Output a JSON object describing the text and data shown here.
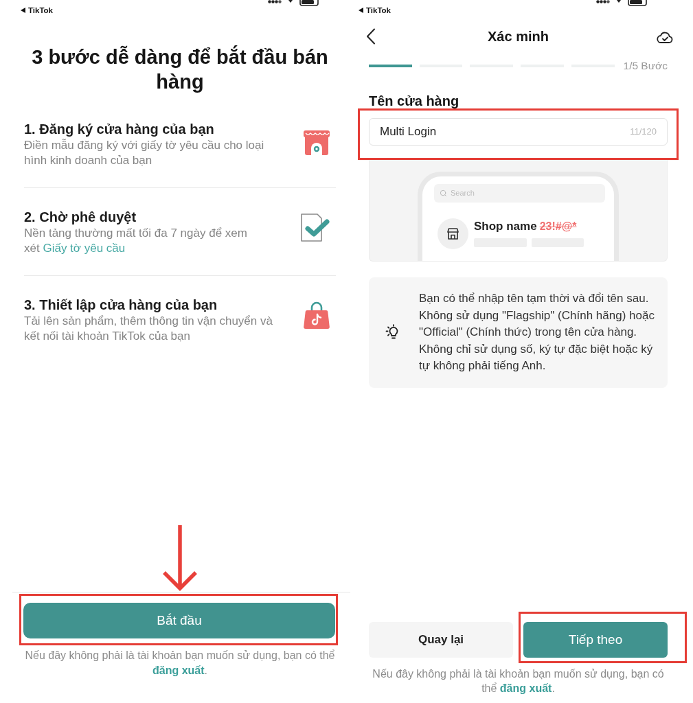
{
  "left": {
    "status_bar": {
      "back_label": "TikTok"
    },
    "title": "3 bước dễ dàng để bắt đầu bán hàng",
    "steps": [
      {
        "kind": "shop",
        "title": "1. Đăng ký cửa hàng của bạn",
        "description": "Điền mẫu đăng ký với giấy tờ yêu cầu cho loại hình kinh doanh của bạn"
      },
      {
        "kind": "approval",
        "title": "2. Chờ phê duyệt",
        "description": "Nền tảng thường mất tối đa 7 ngày để xem xét",
        "link": "Giấy tờ yêu cầu"
      },
      {
        "kind": "setup",
        "title": "3. Thiết lập cửa hàng của bạn",
        "description": "Tải lên sản phẩm, thêm thông tin vận chuyển và kết nối tài khoản TikTok của bạn"
      }
    ],
    "start_button": {
      "label": "Bắt đầu",
      "highlighted": true,
      "arrow": true
    },
    "logout_note": {
      "text": "Nếu đây không phải là tài khoản bạn muốn sử dụng, bạn có thể",
      "link": "đăng xuất",
      "end": "."
    }
  },
  "right": {
    "status_bar": {
      "back_label": "TikTok"
    },
    "header": {
      "title": "Xác minh"
    },
    "progress": {
      "segments": [
        {
          "done": true
        },
        {
          "done": false
        },
        {
          "done": false
        },
        {
          "done": false
        },
        {
          "done": false
        }
      ],
      "label": "1/5 Bước"
    },
    "shop_name": {
      "label": "Tên cửa hàng",
      "value": "Multi Login",
      "counter": "11/120",
      "highlighted": true
    },
    "preview": {
      "search_placeholder": "Search",
      "shop_name": "Shop name",
      "invalid_example": "23!#@*"
    },
    "tip": "Bạn có thể nhập tên tạm thời và đổi tên sau. Không sử dụng \"Flagship\" (Chính hãng) hoặc \"Official\" (Chính thức) trong tên cửa hàng. Không chỉ sử dụng số, ký tự đặc biệt hoặc ký tự không phải tiếng Anh.",
    "buttons": [
      {
        "kind": "secondary",
        "label": "Quay lại",
        "highlighted": false
      },
      {
        "kind": "primary",
        "label": "Tiếp theo",
        "highlighted": true
      }
    ],
    "logout_note": {
      "text": "Nếu đây không phải là tài khoản bạn muốn sử dụng, bạn có thể",
      "link": "đăng xuất",
      "end": "."
    }
  }
}
